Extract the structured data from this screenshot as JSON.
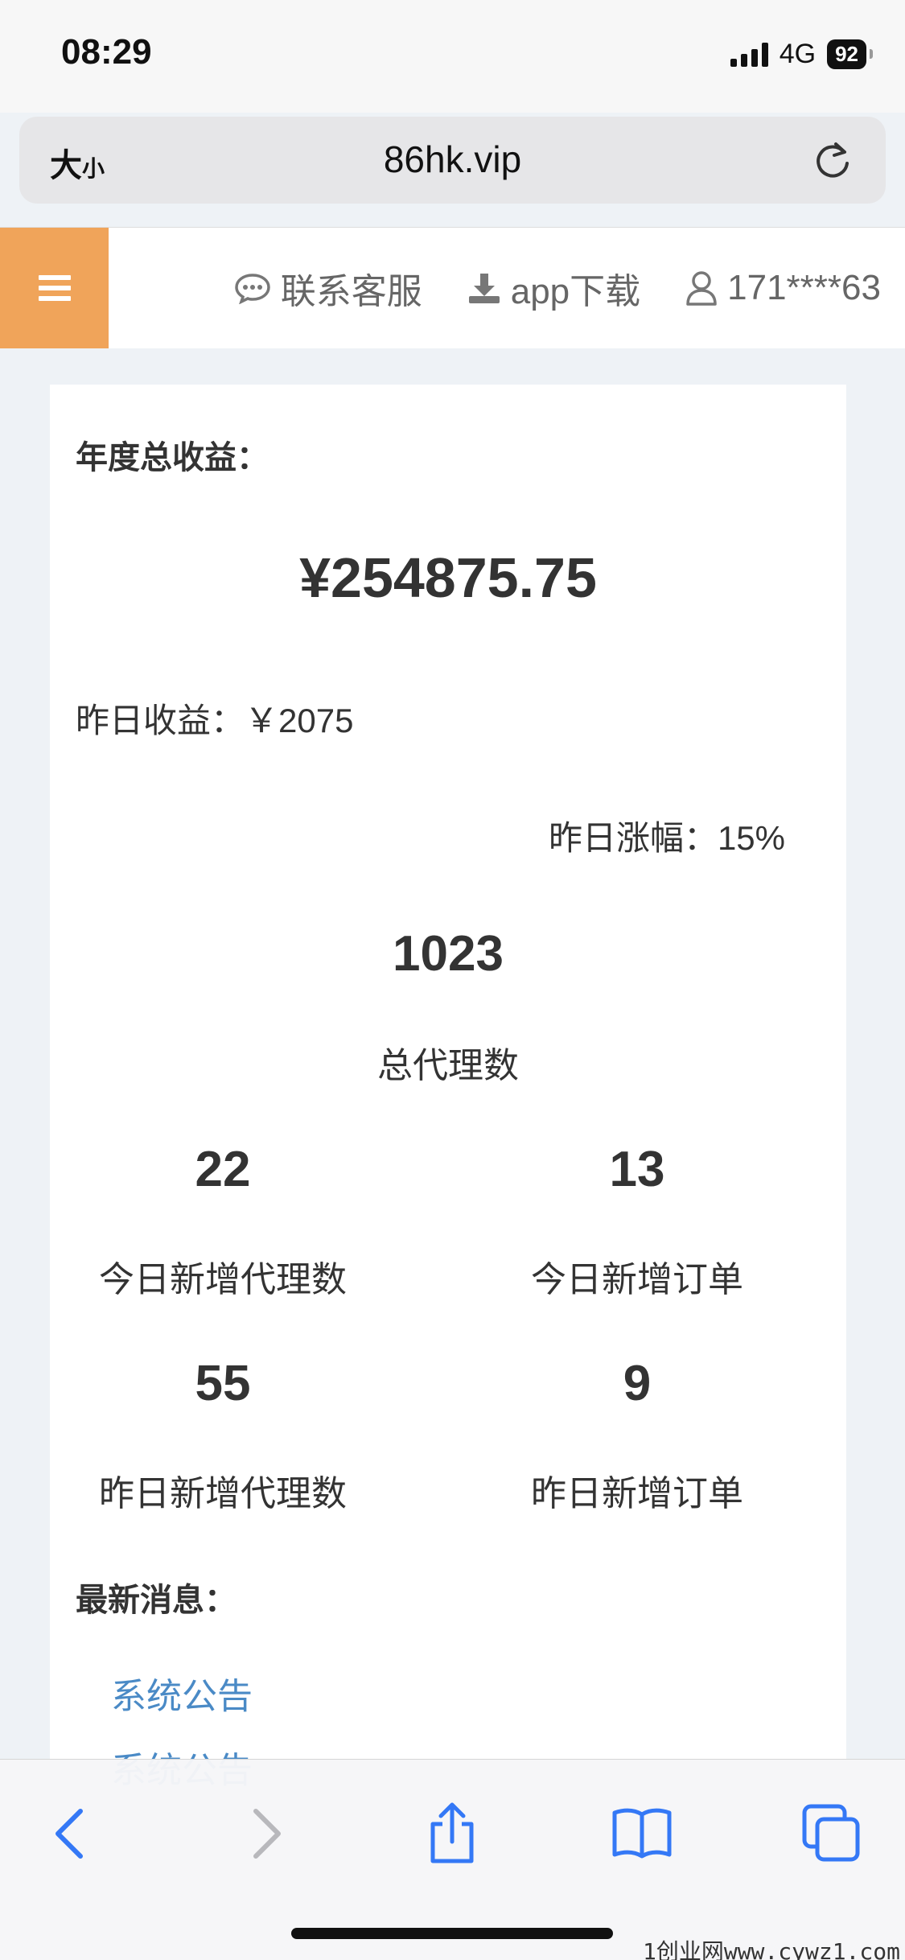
{
  "status_bar": {
    "time": "08:29",
    "network": "4G",
    "battery": "92"
  },
  "browser": {
    "text_size_big": "大",
    "text_size_small": "小",
    "url": "86hk.vip"
  },
  "header": {
    "nav": [
      {
        "icon": "chat-icon",
        "label": "联系客服"
      },
      {
        "icon": "download-icon",
        "label": "app下载"
      },
      {
        "icon": "user-icon",
        "label": "171****63"
      }
    ]
  },
  "stats": {
    "annual_label": "年度总收益：",
    "annual_amount": "¥254875.75",
    "yesterday_income": "昨日收益：￥2075",
    "yesterday_growth": "昨日涨幅：15%",
    "total_agents": {
      "value": "1023",
      "label": "总代理数"
    },
    "today_new_agents": {
      "value": "22",
      "label": "今日新增代理数"
    },
    "today_new_orders": {
      "value": "13",
      "label": "今日新增订单"
    },
    "yesterday_new_agents": {
      "value": "55",
      "label": "昨日新增代理数"
    },
    "yesterday_new_orders": {
      "value": "9",
      "label": "昨日新增订单"
    }
  },
  "news": {
    "label": "最新消息：",
    "items": [
      "系统公告",
      "系统公告"
    ]
  },
  "toolbar": [
    "back-icon",
    "forward-icon",
    "share-icon",
    "bookmarks-icon",
    "tabs-icon"
  ],
  "watermark": "1创业网www.cywz1.com",
  "colors": {
    "accent": "#f0a45a",
    "link": "#4a8ac6"
  }
}
